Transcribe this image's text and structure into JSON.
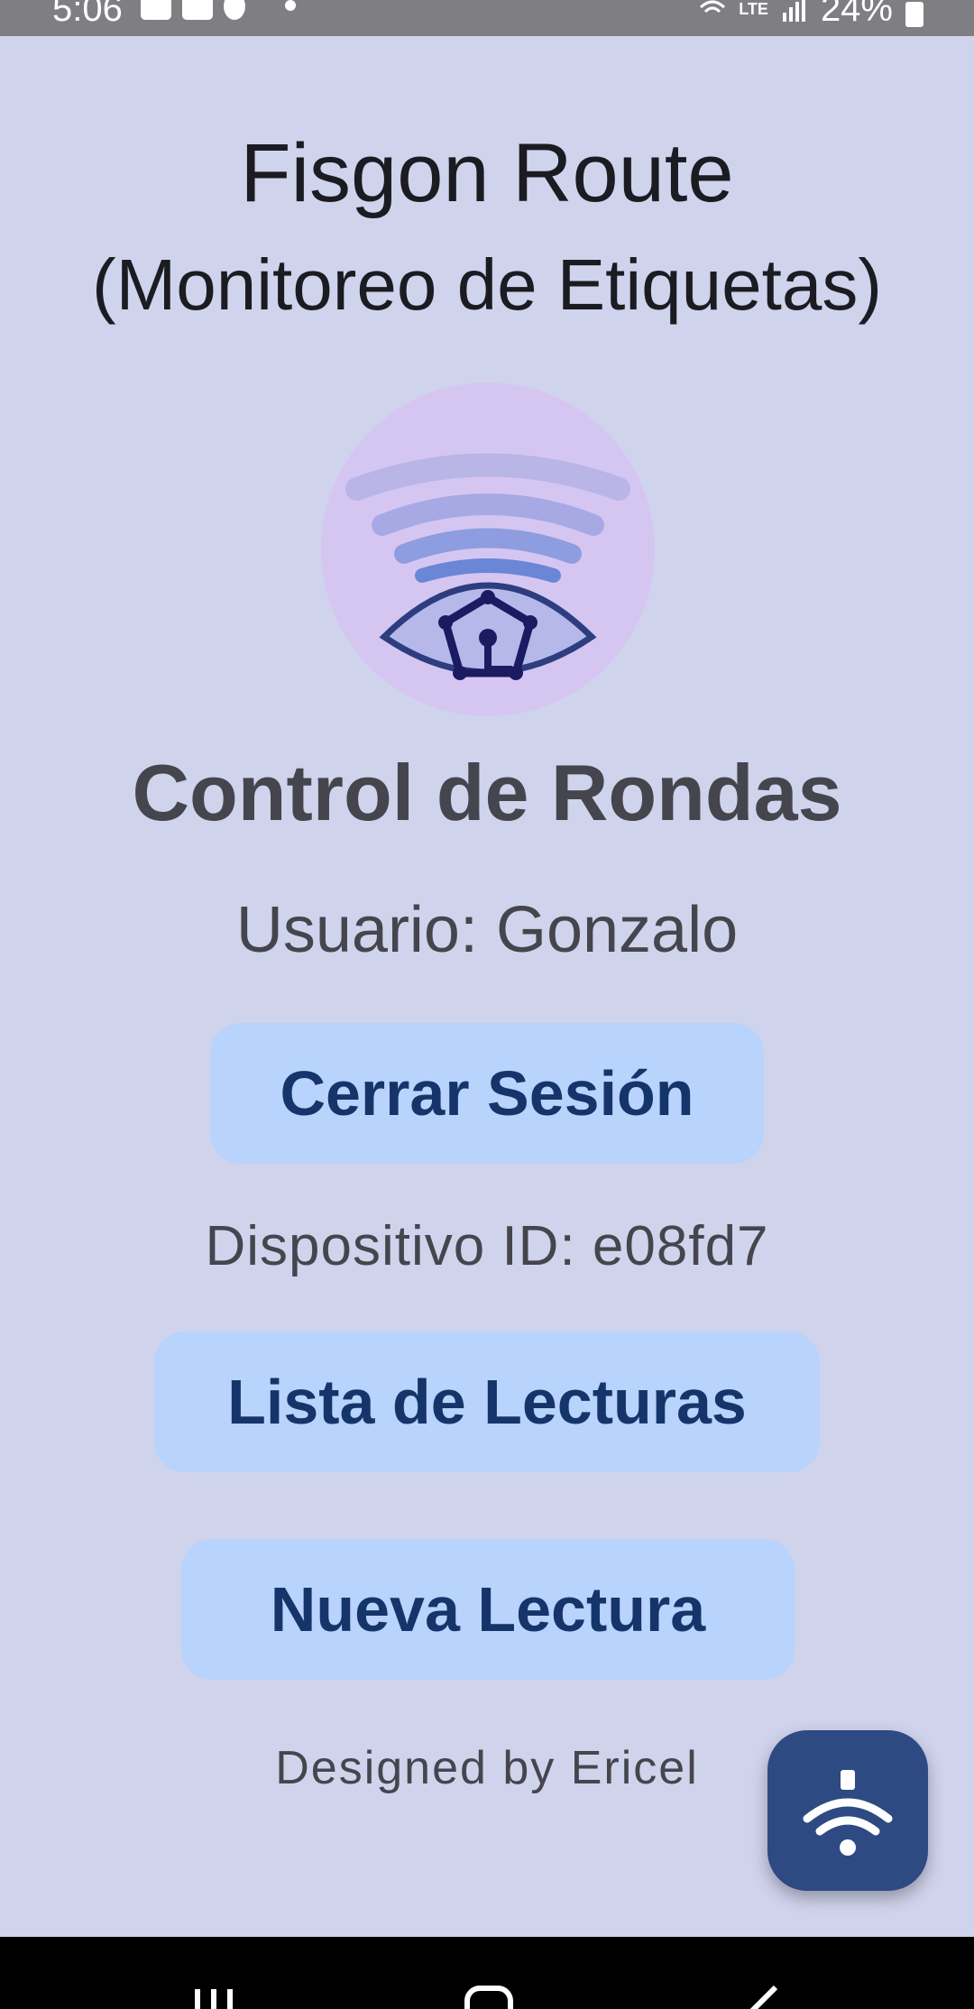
{
  "status_bar": {
    "time": "5:06",
    "network": "LTE",
    "battery": "24%"
  },
  "header": {
    "app_name_bold": "Fisgon",
    "app_name_rest": "Route",
    "subtitle": "(Monitoreo de Etiquetas)"
  },
  "logo": {
    "icon": "eye-wifi-house-logo",
    "circle_color": "#d5c6f1",
    "wave_color": "#a9a8e3",
    "eye_color": "#2d3d80"
  },
  "main": {
    "heading": "Control de Rondas",
    "user_label": "Usuario: Gonzalo",
    "logout_button": "Cerrar Sesión",
    "device_label": "Dispositivo ID: e08fd7",
    "list_button": "Lista de Lecturas",
    "new_button": "Nueva Lectura",
    "credit": "Designed by Ericel"
  },
  "fab": {
    "icon": "nfc-wifi-icon",
    "color": "#2e4a82"
  },
  "colors": {
    "background": "#d0d3ec",
    "button_bg": "#b8d3fc",
    "button_text": "#15356a",
    "text": "#45464d"
  },
  "nav_bar": {
    "icons": [
      "recents-icon",
      "home-icon",
      "back-icon"
    ]
  }
}
